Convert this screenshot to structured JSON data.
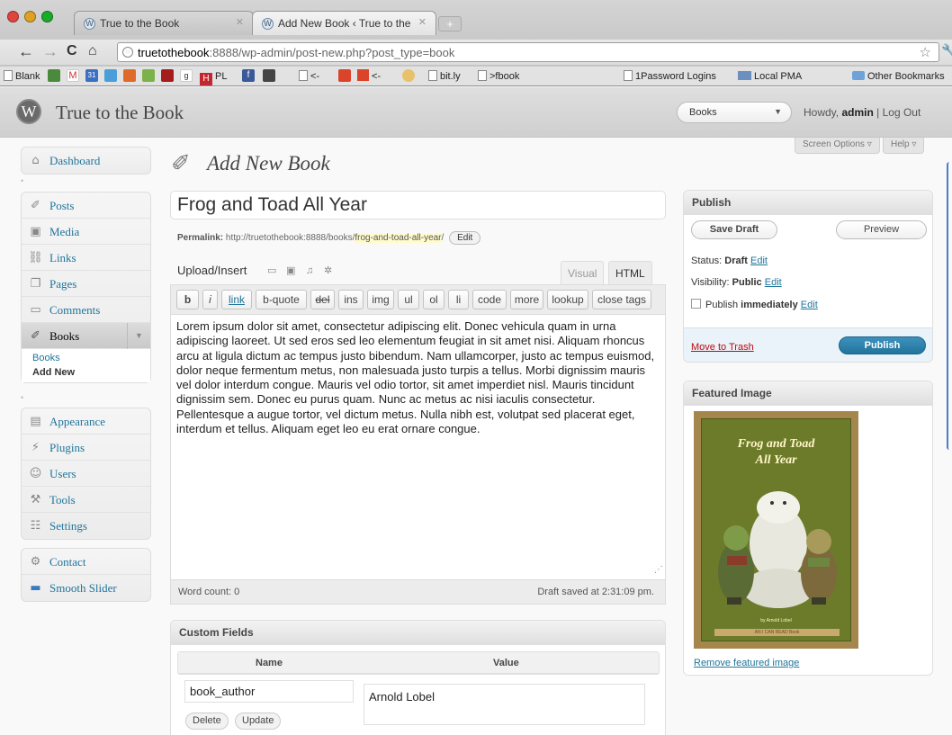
{
  "browser": {
    "tabs": [
      {
        "label": "True to the Book"
      },
      {
        "label": "Add New Book ‹ True to the"
      }
    ],
    "url_host": "truetothebook",
    "url_rest": ":8888/wp-admin/post-new.php?post_type=book",
    "bookmarks": [
      "Blank",
      "PL",
      "<-",
      "<-",
      "bit.ly",
      ">fbook",
      "1Password Logins",
      "Local PMA",
      "Other Bookmarks"
    ]
  },
  "wp": {
    "site_title": "True to the Book",
    "favorites": "Books",
    "howdy_prefix": "Howdy, ",
    "user": "admin",
    "sep": " | ",
    "logout": "Log Out",
    "screen_options": "Screen Options",
    "help": "Help"
  },
  "menu": {
    "dashboard": "Dashboard",
    "posts": "Posts",
    "media": "Media",
    "links": "Links",
    "pages": "Pages",
    "comments": "Comments",
    "books": "Books",
    "books_sub": [
      "Books",
      "Add New"
    ],
    "appearance": "Appearance",
    "plugins": "Plugins",
    "users": "Users",
    "tools": "Tools",
    "settings": "Settings",
    "contact": "Contact",
    "smooth_slider": "Smooth Slider"
  },
  "editor": {
    "page_title": "Add New Book",
    "post_title": "Frog and Toad All Year",
    "permalink_label": "Permalink:",
    "permalink_base": "http://truetothebook:8888/books/",
    "permalink_slug": "frog-and-toad-all-year",
    "permalink_trail": "/",
    "permalink_edit": "Edit",
    "upload_insert": "Upload/Insert",
    "tab_visual": "Visual",
    "tab_html": "HTML",
    "quicktags": [
      "b",
      "i",
      "link",
      "b-quote",
      "del",
      "ins",
      "img",
      "ul",
      "ol",
      "li",
      "code",
      "more",
      "lookup",
      "close tags"
    ],
    "content": "Lorem ipsum dolor sit amet, consectetur adipiscing elit. Donec vehicula quam in urna adipiscing laoreet. Ut sed eros sed leo elementum feugiat in sit amet nisi. Aliquam rhoncus arcu at ligula dictum ac tempus justo bibendum. Nam ullamcorper, justo ac tempus euismod, dolor neque fermentum metus, non malesuada justo turpis a tellus. Morbi dignissim mauris vel dolor interdum congue. Mauris vel odio tortor, sit amet imperdiet nisl. Mauris tincidunt dignissim sem. Donec eu purus quam. Nunc ac metus ac nisi iaculis consectetur. Pellentesque a augue tortor, vel dictum metus. Nulla nibh est, volutpat sed placerat eget, interdum et tellus. Aliquam eget leo eu erat ornare congue.",
    "word_count": "Word count: 0",
    "draft_saved": "Draft saved at 2:31:09 pm."
  },
  "publish": {
    "title": "Publish",
    "save_draft": "Save Draft",
    "preview": "Preview",
    "status_label": "Status: ",
    "status_value": "Draft",
    "visibility_label": "Visibility: ",
    "visibility_value": "Public",
    "publish_label": "Publish ",
    "publish_value": "immediately",
    "edit": "Edit",
    "move_to_trash": "Move to Trash",
    "publish_button": "Publish"
  },
  "featured": {
    "title": "Featured Image",
    "cover_title_1": "Frog and Toad",
    "cover_title_2": "All Year",
    "cover_author": "by Arnold Lobel",
    "cover_series": "AN I CAN READ Book",
    "remove": "Remove featured image"
  },
  "custom_fields": {
    "title": "Custom Fields",
    "col_name": "Name",
    "col_value": "Value",
    "name": "book_author",
    "value": "Arnold Lobel",
    "delete": "Delete",
    "update": "Update"
  },
  "colors": {
    "link": "#21759b",
    "publish_button": "#21759b",
    "trash": "#bc0b0b"
  }
}
